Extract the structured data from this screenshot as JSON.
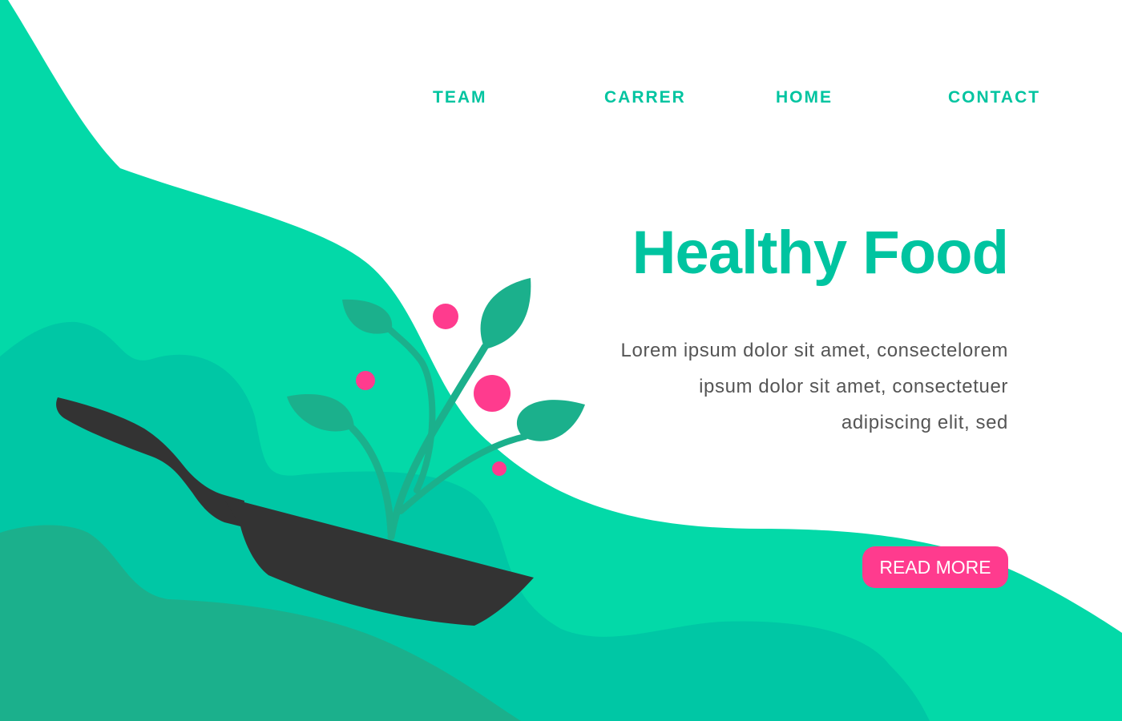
{
  "nav": {
    "items": [
      {
        "label": "TEAM"
      },
      {
        "label": "CARRER"
      },
      {
        "label": "HOME"
      },
      {
        "label": "CONTACT"
      }
    ]
  },
  "hero": {
    "title": "Healthy Food",
    "description_lines": [
      "Lorem ipsum dolor sit amet, consectelorem",
      "ipsum dolor sit amet, consectetuer",
      "adipiscing elit, sed"
    ],
    "cta_label": "READ MORE"
  },
  "illustration": {
    "icons": [
      "frying-pan-icon",
      "plant-sprout-icon",
      "berry-icon"
    ]
  },
  "colors": {
    "brand_green": "#00C4A0",
    "wave_light": "#03D9A8",
    "wave_mid": "#00C7A5",
    "wave_dark": "#1BB08C",
    "leaf": "#1BB08C",
    "berry_pink": "#FF3B8E",
    "pan_dark": "#333333",
    "text_gray": "#555555",
    "button_text": "#FFFFFF"
  }
}
